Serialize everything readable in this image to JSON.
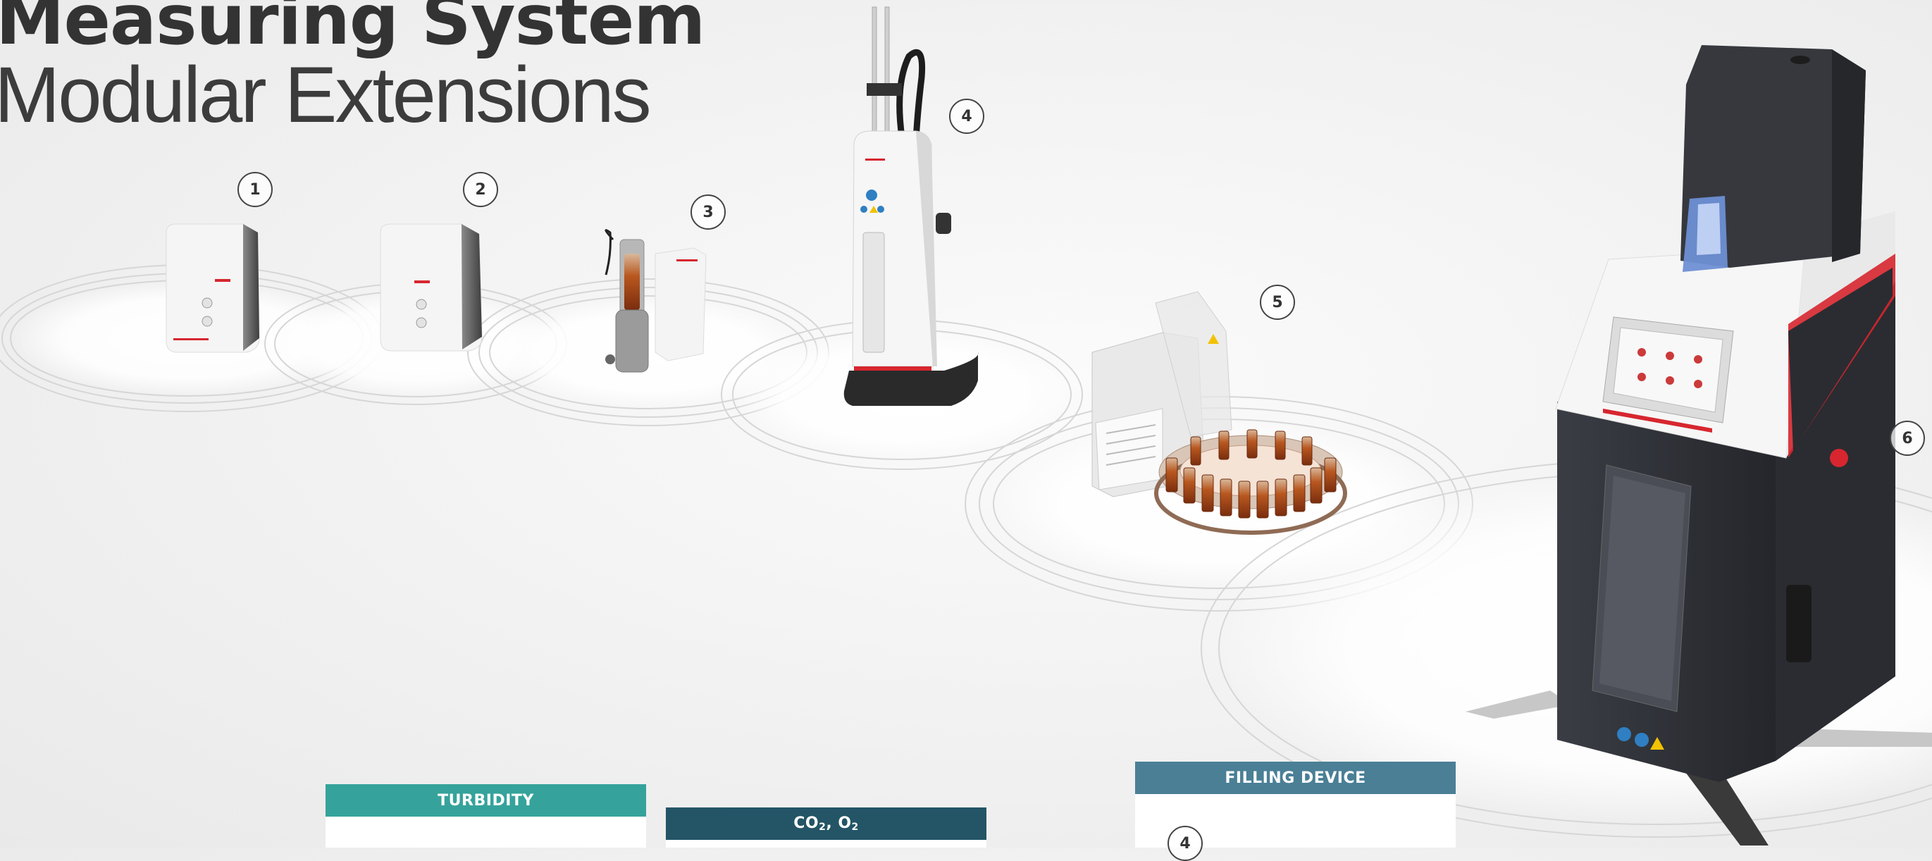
{
  "titles": {
    "line1": "Measuring System",
    "line2": "Modular Extensions"
  },
  "badges": [
    "1",
    "2",
    "3",
    "4",
    "5",
    "6"
  ],
  "panels": {
    "turbidity": {
      "label": "TURBIDITY",
      "color": "#35a39b"
    },
    "co2o2": {
      "label_main": "CO",
      "label_sub1": "2",
      "label_sep": ", O",
      "label_sub2": "2",
      "color": "#235566"
    },
    "filling": {
      "label": "FILLING DEVICE",
      "color": "#4a7f96",
      "inner_badge": "4"
    }
  },
  "colors": {
    "brand_red": "#d7262f",
    "device_white": "#f7f7f7",
    "device_dark": "#2c2f36"
  }
}
